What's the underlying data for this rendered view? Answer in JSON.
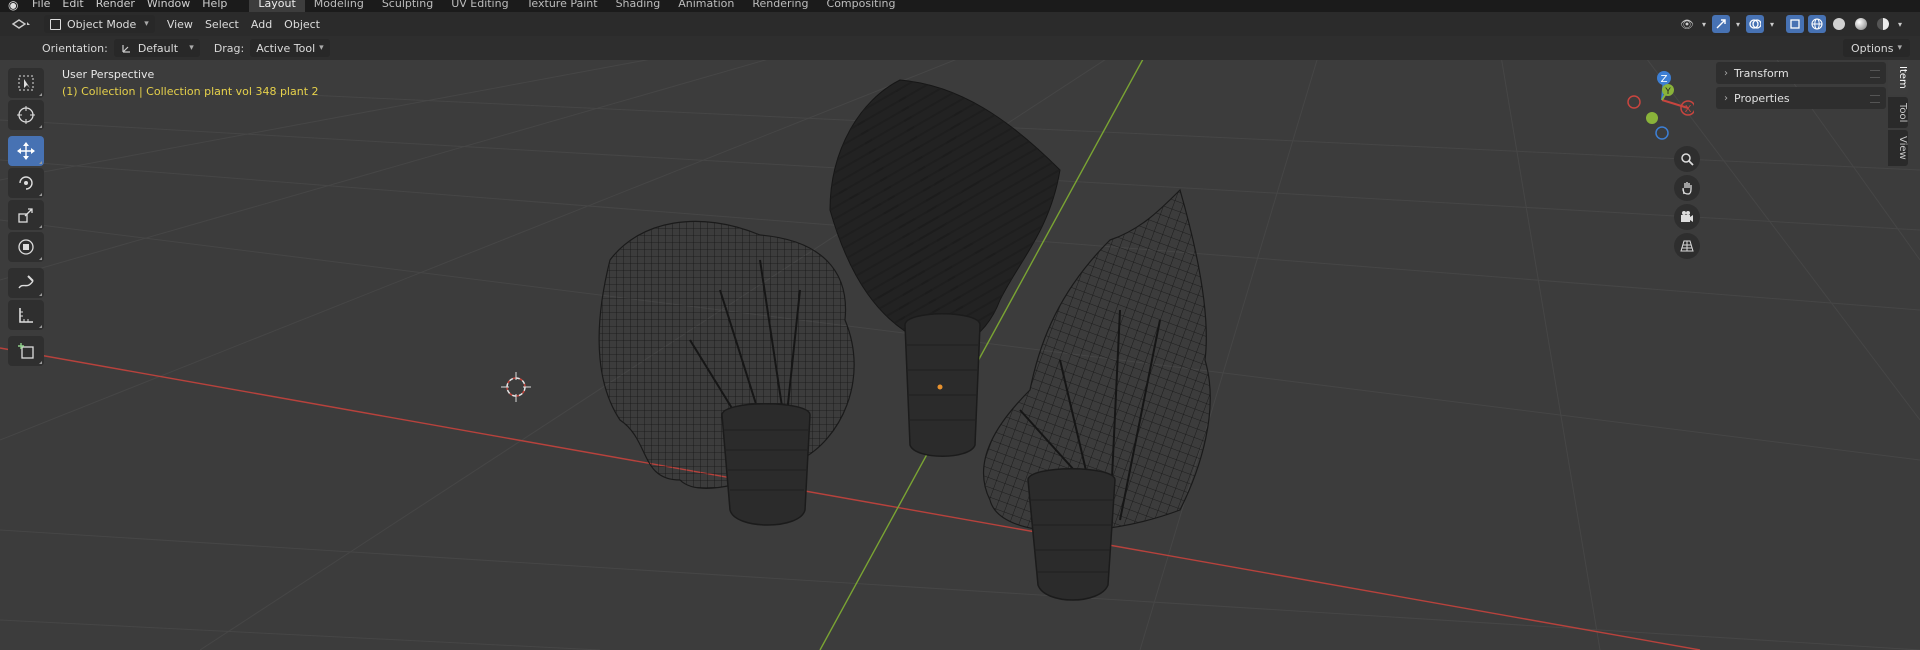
{
  "topbar": {
    "menus": [
      "File",
      "Edit",
      "Render",
      "Window",
      "Help"
    ],
    "workspace_tabs": [
      {
        "label": "Layout",
        "active": true
      },
      {
        "label": "Modeling"
      },
      {
        "label": "Sculpting"
      },
      {
        "label": "UV Editing"
      },
      {
        "label": "Texture Paint"
      },
      {
        "label": "Shading"
      },
      {
        "label": "Animation"
      },
      {
        "label": "Rendering"
      },
      {
        "label": "Compositing"
      }
    ]
  },
  "header": {
    "mode_label": "Object Mode",
    "menus": [
      "View",
      "Select",
      "Add",
      "Object"
    ]
  },
  "tool_settings": {
    "orientation_label": "Orientation:",
    "orientation_value": "Default",
    "drag_label": "Drag:",
    "drag_value": "Active Tool",
    "options_label": "Options"
  },
  "viewport": {
    "perspective_label": "User Perspective",
    "collection_label": "(1) Collection | Collection plant vol 348 plant 2"
  },
  "gizmo": {
    "x_label": "X",
    "y_label": "Y",
    "z_label": "Z"
  },
  "npanel": {
    "sections": [
      "Transform",
      "Properties"
    ],
    "tabs": [
      "Item",
      "Tool",
      "View"
    ]
  },
  "colors": {
    "x_axis": "#c8453f",
    "y_axis": "#8ab33a",
    "z_axis": "#3d7fd4",
    "active_tool": "#4772b3",
    "collection_text": "#e6d14b"
  }
}
